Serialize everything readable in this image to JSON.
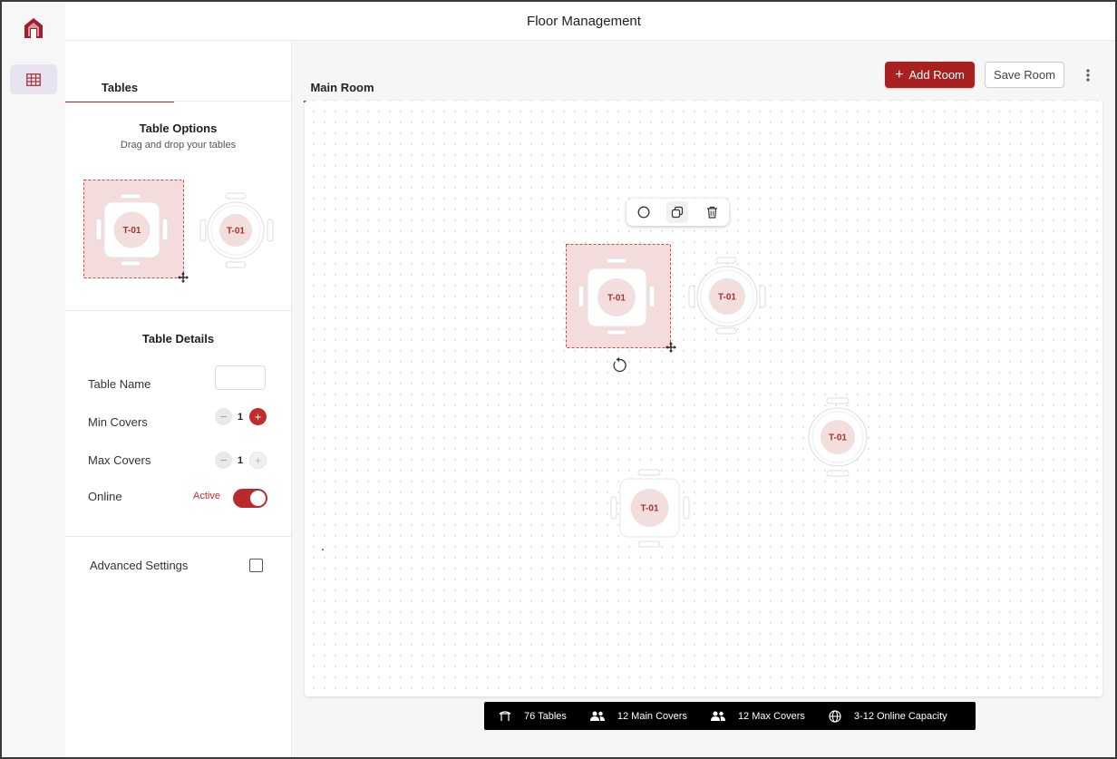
{
  "app": {
    "title": "Floor Management"
  },
  "sidebar": {
    "tab_label": "Tables",
    "options": {
      "title": "Table Options",
      "subtitle": "Drag and drop your tables"
    },
    "details": {
      "title": "Table Details",
      "table_name_label": "Table Name",
      "table_name_value": "",
      "min_covers_label": "Min Covers",
      "min_covers_value": "1",
      "max_covers_label": "Max Covers",
      "max_covers_value": "1",
      "online_label": "Online",
      "online_status": "Active",
      "online_enabled": true
    },
    "advanced_label": "Advanced Settings",
    "advanced_checked": false
  },
  "main": {
    "tab_label": "Main Room",
    "add_room_label": "Add Room",
    "save_room_label": "Save Room"
  },
  "tables": {
    "option_square_label": "T-01",
    "option_round_label": "T-01",
    "canvas_labels": [
      "T-01",
      "T-01",
      "T-01",
      "T-01"
    ]
  },
  "stats": {
    "tables": "76 Tables",
    "main_covers": "12 Main Covers",
    "max_covers": "12 Max Covers",
    "online_capacity": "3-12 Online Capacity"
  },
  "colors": {
    "accent": "#b42a2a",
    "selection_fill": "#f4dcdc",
    "table_seat": "#f3dede"
  },
  "icons": [
    "home-logo-icon",
    "grid-icon",
    "kebab-menu-icon",
    "circle-icon",
    "copy-icon",
    "trash-icon",
    "rotate-icon",
    "move-icon",
    "table-icon",
    "people-icon",
    "globe-icon"
  ]
}
